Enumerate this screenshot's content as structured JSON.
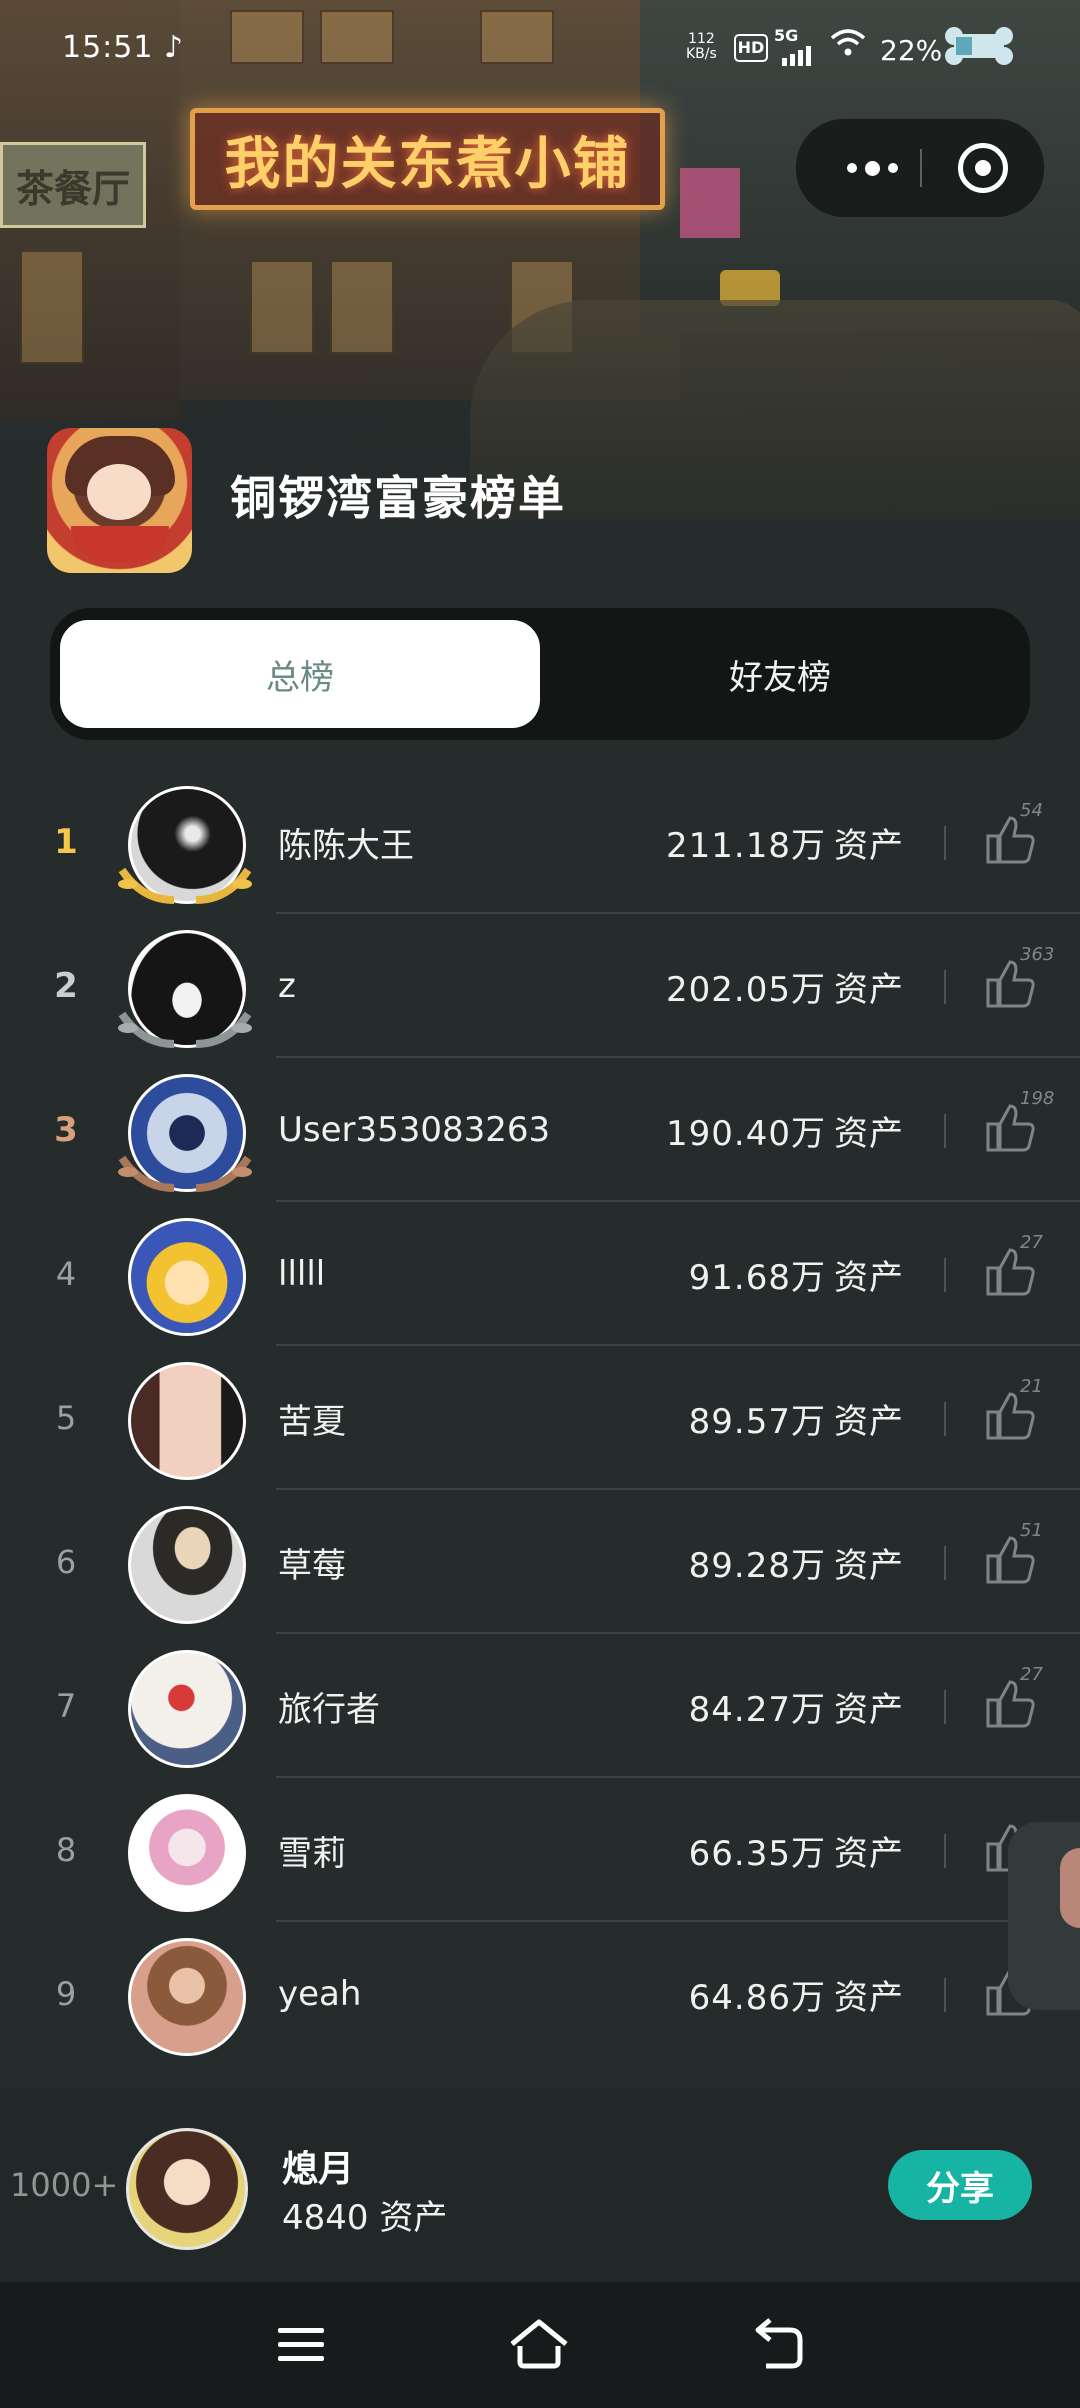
{
  "status_bar": {
    "time": "15:51",
    "net_speed_value": "112",
    "net_speed_unit": "KB/s",
    "hd": "HD",
    "network": "5G",
    "battery": "22%"
  },
  "scene": {
    "shop_sign": "我的关东煮小铺",
    "side_sign": "茶餐厅"
  },
  "header": {
    "title": "铜锣湾富豪榜单"
  },
  "tabs": [
    {
      "label": "总榜",
      "active": true
    },
    {
      "label": "好友榜",
      "active": false
    }
  ],
  "asset_unit": "资产",
  "leaderboard": [
    {
      "rank": "1",
      "name": "陈陈大王",
      "assets": "211.18万",
      "likes": "54"
    },
    {
      "rank": "2",
      "name": "z",
      "assets": "202.05万",
      "likes": "363"
    },
    {
      "rank": "3",
      "name": "User353083263",
      "assets": "190.40万",
      "likes": "198"
    },
    {
      "rank": "4",
      "name": "lllll",
      "assets": "91.68万",
      "likes": "27"
    },
    {
      "rank": "5",
      "name": "苦夏",
      "assets": "89.57万",
      "likes": "21"
    },
    {
      "rank": "6",
      "name": "草莓",
      "assets": "89.28万",
      "likes": "51"
    },
    {
      "rank": "7",
      "name": "旅行者",
      "assets": "84.27万",
      "likes": "27"
    },
    {
      "rank": "8",
      "name": "雪莉",
      "assets": "66.35万",
      "likes": ""
    },
    {
      "rank": "9",
      "name": "yeah",
      "assets": "64.86万",
      "likes": ""
    }
  ],
  "my_entry": {
    "rank": "1000+",
    "name": "熄月",
    "assets": "4840 资产",
    "share_label": "分享"
  },
  "colors": {
    "background": "#262c2c",
    "gold": "#f4c84a",
    "silver": "#c9cfd1",
    "bronze": "#d9a07a",
    "accent": "#17b3a3"
  }
}
